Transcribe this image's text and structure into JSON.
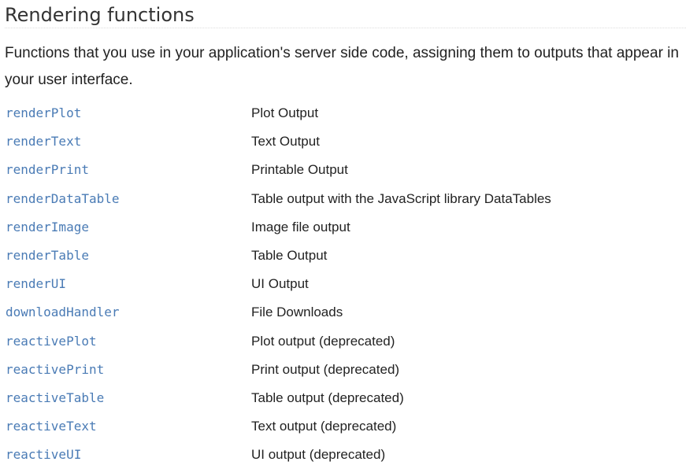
{
  "section": {
    "title": "Rendering functions",
    "description": "Functions that you use in your application's server side code, assigning them to outputs that appear in your user interface."
  },
  "functions": [
    {
      "name": "renderPlot",
      "description": "Plot Output"
    },
    {
      "name": "renderText",
      "description": "Text Output"
    },
    {
      "name": "renderPrint",
      "description": "Printable Output"
    },
    {
      "name": "renderDataTable",
      "description": "Table output with the JavaScript library DataTables"
    },
    {
      "name": "renderImage",
      "description": "Image file output"
    },
    {
      "name": "renderTable",
      "description": "Table Output"
    },
    {
      "name": "renderUI",
      "description": "UI Output"
    },
    {
      "name": "downloadHandler",
      "description": "File Downloads"
    },
    {
      "name": "reactivePlot",
      "description": "Plot output (deprecated)"
    },
    {
      "name": "reactivePrint",
      "description": "Print output (deprecated)"
    },
    {
      "name": "reactiveTable",
      "description": "Table output (deprecated)"
    },
    {
      "name": "reactiveText",
      "description": "Text output (deprecated)"
    },
    {
      "name": "reactiveUI",
      "description": "UI output (deprecated)"
    }
  ],
  "colors": {
    "link": "#4a7bb5",
    "text": "#222222",
    "heading": "#333333"
  }
}
